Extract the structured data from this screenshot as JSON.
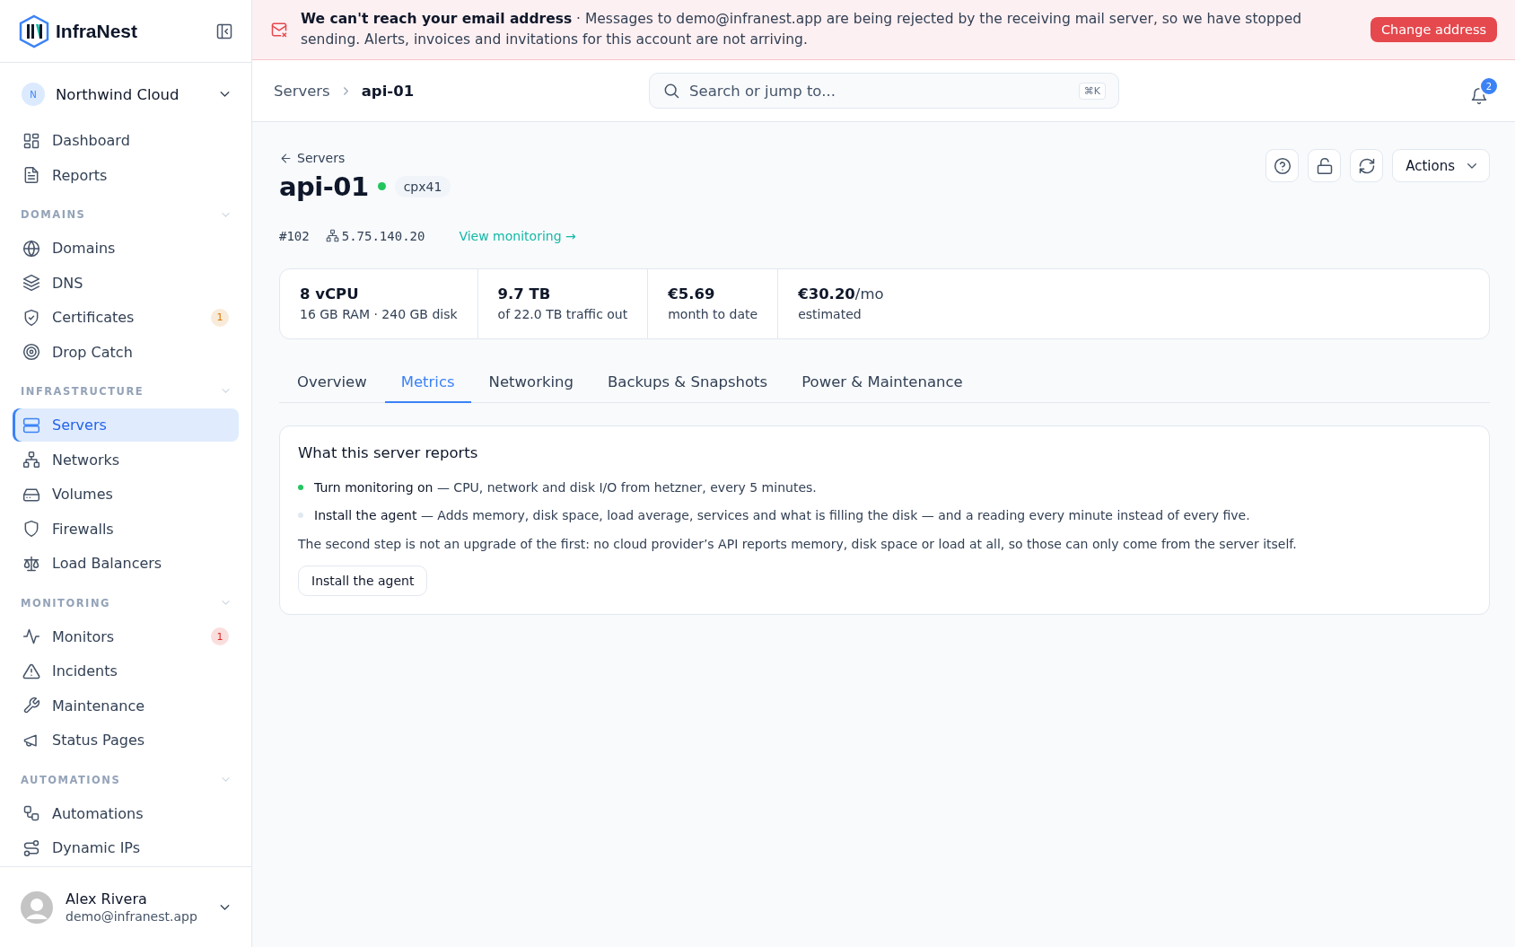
{
  "sidebar": {
    "brand": "InfraNest",
    "workspace": {
      "initial": "N",
      "name": "Northwind Cloud"
    },
    "groups": [
      {
        "items": [
          {
            "label": "Dashboard",
            "selected": false
          },
          {
            "label": "Reports",
            "selected": false
          }
        ]
      },
      {
        "heading": "DOMAINS",
        "expanded": true,
        "items": [
          {
            "label": "Domains",
            "selected": false
          },
          {
            "label": "DNS",
            "selected": false
          },
          {
            "label": "Certificates",
            "selected": false,
            "badge": {
              "text": "1",
              "color": "#d97706"
            }
          },
          {
            "label": "Drop Catch",
            "selected": false
          }
        ]
      },
      {
        "heading": "INFRASTRUCTURE",
        "expanded": true,
        "items": [
          {
            "label": "Servers",
            "selected": true
          },
          {
            "label": "Networks",
            "selected": false
          },
          {
            "label": "Volumes",
            "selected": false
          },
          {
            "label": "Firewalls",
            "selected": false
          },
          {
            "label": "Load Balancers",
            "selected": false
          }
        ]
      },
      {
        "heading": "MONITORING",
        "expanded": true,
        "items": [
          {
            "label": "Monitors",
            "selected": false,
            "badge": {
              "text": "1",
              "color": "#dc2626"
            }
          },
          {
            "label": "Incidents",
            "selected": false
          },
          {
            "label": "Maintenance",
            "selected": false
          },
          {
            "label": "Status Pages",
            "selected": false
          }
        ]
      },
      {
        "heading": "AUTOMATIONS",
        "expanded": true,
        "items": [
          {
            "label": "Automations",
            "selected": false
          },
          {
            "label": "Dynamic IPs",
            "selected": false
          }
        ]
      }
    ],
    "user": {
      "name": "Alex Rivera",
      "email": "demo@infranest.app"
    }
  },
  "banner": {
    "message": "**We can't reach your email address** · Messages to demo@infranest.app are being rejected by the receiving mail server, so we have stopped sending. Alerts, invoices and invitations for this account are not arriving.",
    "button": "Change address"
  },
  "header": {
    "breadcrumb": [
      "Servers",
      "api-01"
    ],
    "search": {
      "placeholder": "Search or jump to...",
      "shortcut": "⌘K"
    },
    "notifications": "2"
  },
  "server": {
    "back": "Servers",
    "name": "api-01",
    "online": true,
    "plan": "cpx41",
    "id": "#102",
    "ip": "5.75.140.20",
    "monitoring_link": "View monitoring →",
    "actions": "Actions"
  },
  "stats": [
    {
      "value": "8 vCPU",
      "detail": "16 GB RAM · 240 GB disk"
    },
    {
      "value": "9.7 TB",
      "detail": "of 22.0 TB traffic out"
    },
    {
      "value": "€5.69",
      "detail": "month to date"
    },
    {
      "value": "€30.20/mo",
      "detail": "estimated"
    }
  ],
  "tabs": [
    {
      "label": "Overview",
      "selected": false
    },
    {
      "label": "Metrics",
      "selected": true
    },
    {
      "label": "Networking",
      "selected": false
    },
    {
      "label": "Backups & Snapshots",
      "selected": false
    },
    {
      "label": "Power & Maintenance",
      "selected": false
    }
  ],
  "reports": {
    "title": "What this server reports",
    "steps": [
      {
        "text": "**Turn monitoring on** — CPU, network and disk I/O from hetzner, every 5 minutes.",
        "done": true
      },
      {
        "text": "**Install the agent** — Adds memory, disk space, load average, services and what is filling the disk — and a reading every minute instead of every five.",
        "done": false
      }
    ],
    "note": "The second step is not an upgrade of the first: no cloud provider’s API reports memory, disk space or load at all, so those can only come from the server itself.",
    "button": "Install the agent"
  }
}
